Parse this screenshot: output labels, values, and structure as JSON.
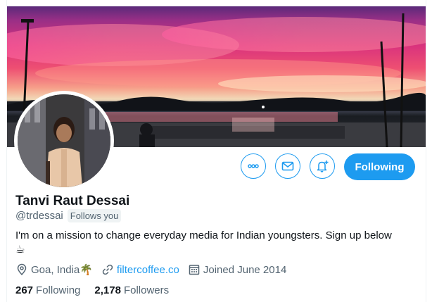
{
  "profile": {
    "display_name": "Tanvi Raut Dessai",
    "handle": "@trdessai",
    "follows_you_badge": "Follows you",
    "bio": "I'm on a mission to change everyday media for Indian youngsters. Sign up below",
    "bio_emoji": "☕",
    "location": "Goa, India",
    "location_emoji": "🌴",
    "website": "filtercoffee.co",
    "joined": "Joined June 2014"
  },
  "stats": {
    "following_count": "267",
    "following_label": "Following",
    "followers_count": "2,178",
    "followers_label": "Followers"
  },
  "actions": {
    "follow_label": "Following"
  },
  "icons": {
    "more": "more-icon",
    "message": "envelope-icon",
    "notify": "bell-plus-icon",
    "location": "location-pin-icon",
    "link": "link-icon",
    "calendar": "calendar-icon"
  },
  "colors": {
    "accent": "#1d9bf0",
    "text": "#0f1419",
    "secondary": "#536471"
  }
}
